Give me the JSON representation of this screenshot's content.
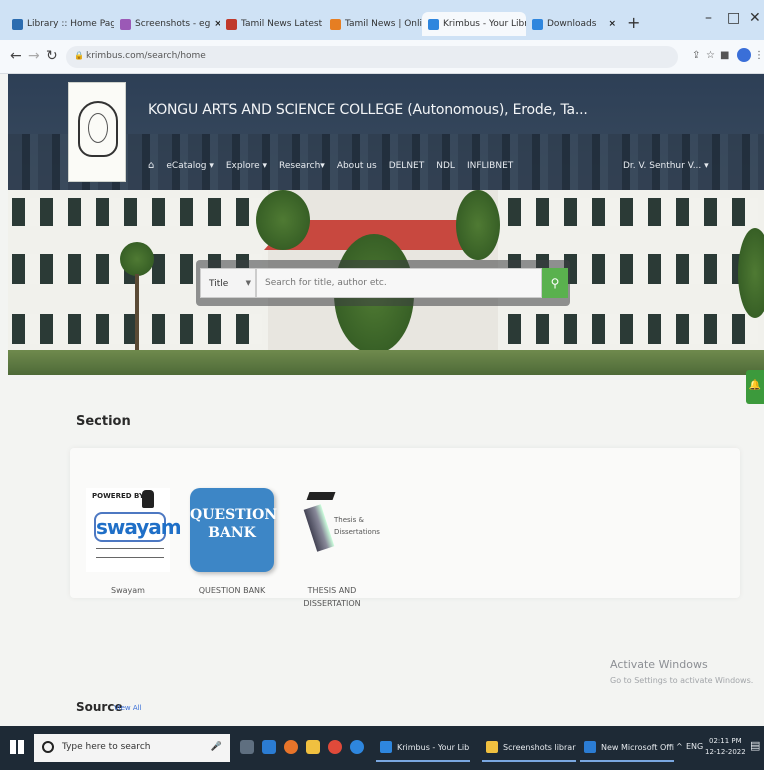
{
  "browser": {
    "tabs": [
      {
        "title": "Library :: Home Page",
        "color": "#2b6cb0"
      },
      {
        "title": "Screenshots - eg",
        "color": "#9b59b6"
      },
      {
        "title": "Tamil News Latest",
        "color": "#c0392b"
      },
      {
        "title": "Tamil News | Online",
        "color": "#e67e22"
      },
      {
        "title": "Krimbus - Your Libra",
        "color": "#2e86de",
        "active": true
      },
      {
        "title": "Downloads",
        "color": "#2e86de"
      }
    ],
    "new_tab": "+",
    "url": "krimbus.com/search/home",
    "window_controls": {
      "minimize": "–",
      "maximize": "□",
      "close": "✕"
    }
  },
  "header": {
    "college": "KONGU ARTS AND SCIENCE COLLEGE (Autonomous), Erode, Ta...",
    "menu": [
      "eCatalog ▾",
      "Explore ▾",
      "Research▾",
      "About us",
      "DELNET",
      "NDL",
      "INFLIBNET"
    ],
    "user": "Dr. V. Senthur V... ▾"
  },
  "search": {
    "field": "Title",
    "placeholder": "Search for title, author etc.",
    "button_icon": "search-icon"
  },
  "section": {
    "title": "Section",
    "items": [
      {
        "label": "Swayam",
        "powered": "POWERED BY",
        "logo": "swayam"
      },
      {
        "label": "QUESTION BANK",
        "logo_line1": "QUESTION",
        "logo_line2": "BANK"
      },
      {
        "label": "THESIS AND DISSERTATION",
        "logo_text": "Thesis & Dissertations"
      }
    ]
  },
  "source": {
    "title": "Source",
    "view_all": "View All"
  },
  "windows_notice": {
    "title": "Activate Windows",
    "subtitle": "Go to Settings to activate Windows."
  },
  "taskbar": {
    "search_placeholder": "Type here to search",
    "apps": [
      {
        "label": "Krimbus - Your Lib...",
        "color": "#2e86de"
      },
      {
        "label": "Screenshots library...",
        "color": "#f0c040"
      },
      {
        "label": "New Microsoft Offi...",
        "color": "#2b7cd3"
      }
    ],
    "lang": "ENG",
    "time": "02:11 PM",
    "date": "12-12-2022"
  }
}
